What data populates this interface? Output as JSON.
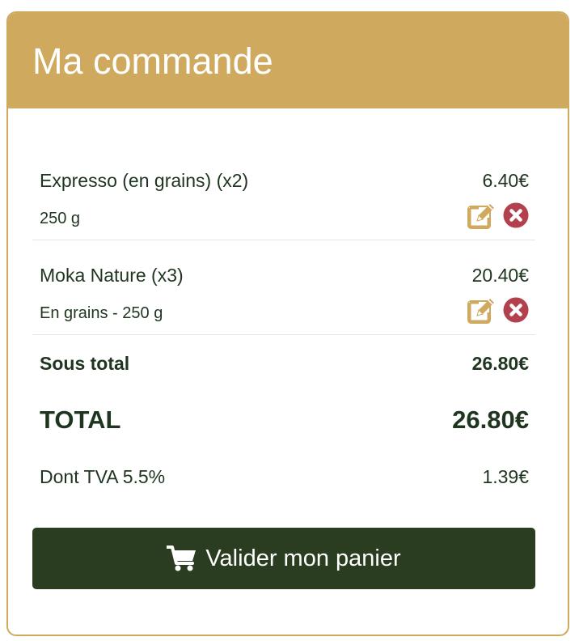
{
  "header": {
    "title": "Ma commande"
  },
  "items": [
    {
      "name": "Expresso (en grains) (x2)",
      "price": "6.40€",
      "detail": "250 g"
    },
    {
      "name": "Moka Nature (x3)",
      "price": "20.40€",
      "detail": "En grains - 250 g"
    }
  ],
  "summary": {
    "subtotal_label": "Sous total",
    "subtotal_value": "26.80€",
    "total_label": "TOTAL",
    "total_value": "26.80€",
    "tva_label": "Dont TVA 5.5%",
    "tva_value": "1.39€"
  },
  "actions": {
    "validate_label": "Valider mon panier"
  },
  "icons": {
    "edit": "edit-icon",
    "remove": "remove-circle-icon",
    "cart": "shopping-cart-icon"
  },
  "colors": {
    "accent": "#cfa95e",
    "text": "#1f3520",
    "button_bg": "#2a3d20",
    "remove": "#b2404d"
  }
}
